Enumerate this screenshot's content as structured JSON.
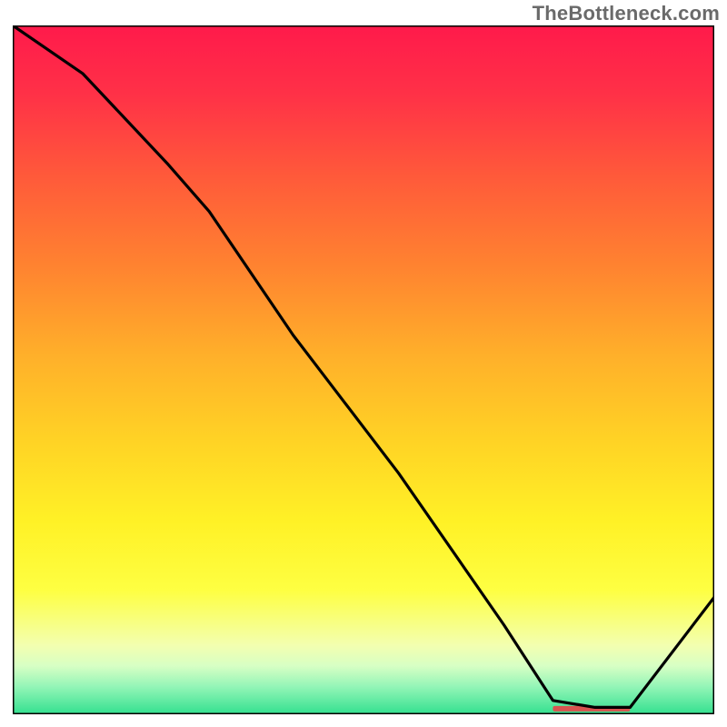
{
  "watermark": "TheBottleneck.com",
  "chart_data": {
    "type": "line",
    "title": "",
    "xlabel": "",
    "ylabel": "",
    "xlim": [
      0,
      100
    ],
    "ylim": [
      0,
      100
    ],
    "grid": false,
    "curve": {
      "x": [
        0,
        10,
        22,
        28,
        40,
        55,
        70,
        77,
        83,
        88,
        100
      ],
      "y": [
        100,
        93,
        80,
        73,
        55,
        35,
        13,
        2,
        1,
        1,
        17
      ]
    },
    "marker_band": {
      "x0": 77,
      "x1": 88,
      "y": 0.8,
      "color": "#d9534f"
    },
    "gradient_stops": [
      {
        "offset": 0.0,
        "color": "#ff1a4b"
      },
      {
        "offset": 0.1,
        "color": "#ff3147"
      },
      {
        "offset": 0.22,
        "color": "#ff5a3a"
      },
      {
        "offset": 0.35,
        "color": "#ff8330"
      },
      {
        "offset": 0.48,
        "color": "#ffb02a"
      },
      {
        "offset": 0.6,
        "color": "#ffd225"
      },
      {
        "offset": 0.72,
        "color": "#fff126"
      },
      {
        "offset": 0.82,
        "color": "#feff42"
      },
      {
        "offset": 0.9,
        "color": "#f3ffb0"
      },
      {
        "offset": 0.93,
        "color": "#d7ffc4"
      },
      {
        "offset": 0.96,
        "color": "#93f5b7"
      },
      {
        "offset": 1.0,
        "color": "#33e08f"
      }
    ]
  }
}
